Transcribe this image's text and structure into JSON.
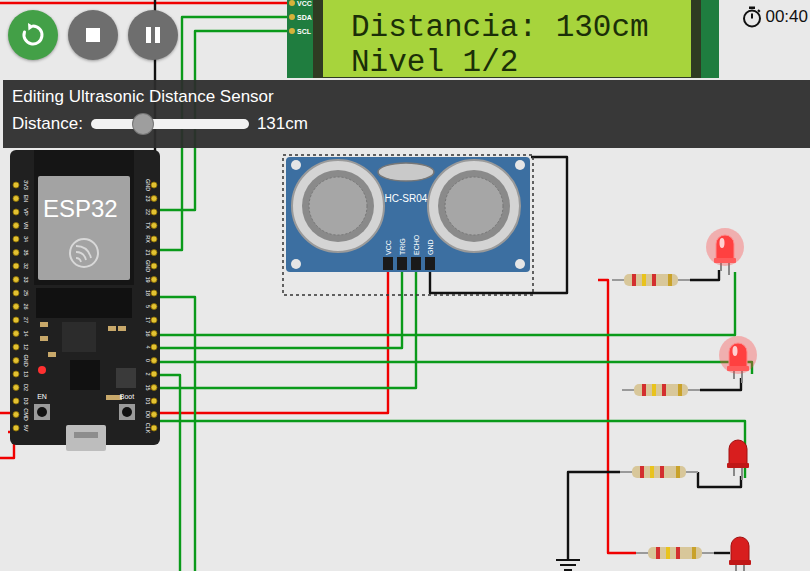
{
  "controls": [
    {
      "kind": "restart",
      "color": "#43a047"
    },
    {
      "kind": "stop",
      "color": "#6e6e6e"
    },
    {
      "kind": "pause",
      "color": "#6e6e6e"
    }
  ],
  "timer": "00:40",
  "lcd": {
    "lines": [
      "Distancia: 130cm",
      "Nivel 1/2"
    ],
    "pins": [
      "VCC",
      "SDA",
      "SCL"
    ]
  },
  "editor": {
    "title": "Editing Ultrasonic Distance Sensor",
    "label": "Distance:",
    "level": 0.33,
    "reading": "131cm"
  },
  "esp32": {
    "label": "ESP32",
    "buttons": [
      "EN",
      "Boot"
    ],
    "pins_left": [
      "3V3",
      "EN",
      "VP",
      "VN",
      "34",
      "35",
      "32",
      "33",
      "25",
      "26",
      "27",
      "14",
      "12",
      "GND",
      "13",
      "D2",
      "D3",
      "CMD",
      "5V"
    ],
    "pins_right": [
      "GND",
      "23",
      "22",
      "TX",
      "RX",
      "21",
      "GND",
      "19",
      "18",
      "5",
      "17",
      "16",
      "4",
      "0",
      "2",
      "15",
      "D1",
      "D0",
      "CLK"
    ]
  },
  "sensor": {
    "label": "HC-SR04",
    "pins": [
      "VCC",
      "TRIG",
      "ECHO",
      "GND"
    ]
  },
  "leds": [
    {
      "on": true
    },
    {
      "on": true
    },
    {
      "on": false
    },
    {
      "on": false
    }
  ]
}
